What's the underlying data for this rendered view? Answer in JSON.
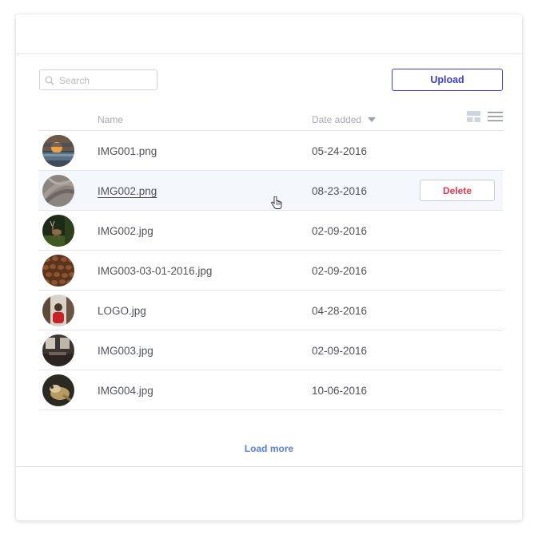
{
  "search": {
    "placeholder": "Search",
    "value": ""
  },
  "toolbar": {
    "upload_label": "Upload"
  },
  "table": {
    "headers": {
      "name": "Name",
      "date_added": "Date added"
    },
    "rows": [
      {
        "name": "IMG001.png",
        "date": "05-24-2016",
        "thumb": "sunset-sea"
      },
      {
        "name": "IMG002.png",
        "date": "08-23-2016",
        "thumb": "feather-texture",
        "hovered": true,
        "delete_label": "Delete"
      },
      {
        "name": "IMG002.jpg",
        "date": "02-09-2016",
        "thumb": "deer-forest"
      },
      {
        "name": "IMG003-03-01-2016.jpg",
        "date": "02-09-2016",
        "thumb": "coffee-beans"
      },
      {
        "name": "LOGO.jpg",
        "date": "04-28-2016",
        "thumb": "person-red-shirt"
      },
      {
        "name": "IMG003.jpg",
        "date": "02-09-2016",
        "thumb": "cafe-interior"
      },
      {
        "name": "IMG004.jpg",
        "date": "10-06-2016",
        "thumb": "bird-hand"
      }
    ]
  },
  "footer": {
    "load_more_label": "Load more"
  },
  "colors": {
    "accent": "#3b3fc9",
    "delete": "#e8384f",
    "link": "#5a7fd6",
    "row_highlight": "#f4f8fd"
  },
  "icons": {
    "search": "search-icon",
    "sort": "sort-caret-down-icon",
    "grid_view": "grid-view-icon",
    "list_view": "list-view-icon",
    "cursor": "hand-pointer-icon"
  }
}
